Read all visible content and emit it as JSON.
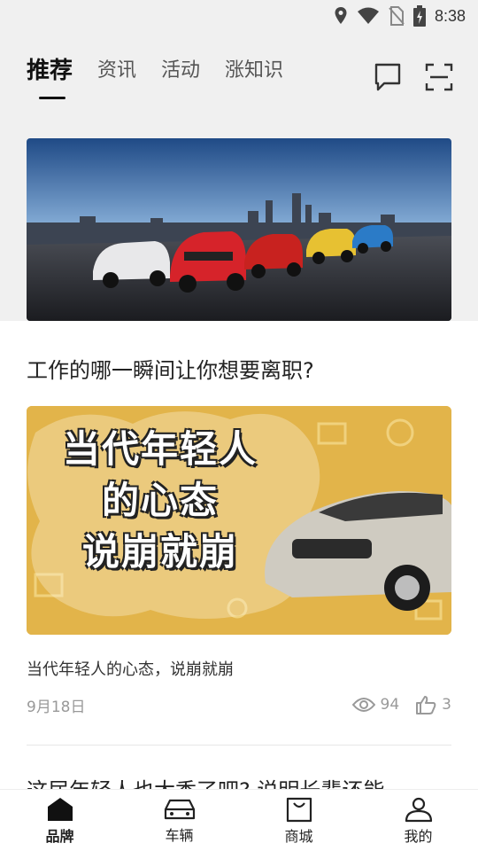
{
  "status_bar": {
    "time": "8:38"
  },
  "tabs": [
    {
      "label": "推荐",
      "active": true
    },
    {
      "label": "资讯",
      "active": false
    },
    {
      "label": "活动",
      "active": false
    },
    {
      "label": "涨知识",
      "active": false
    }
  ],
  "article": {
    "title": "工作的哪一瞬间让你想要离职?",
    "cover_text": [
      "当代年轻人",
      "的心态",
      "说崩就崩"
    ],
    "subtitle": "当代年轻人的心态，说崩就崩",
    "date": "9月18日",
    "views": "94",
    "likes": "3"
  },
  "next_article": {
    "title_partial": "这届年轻人也太香了吧? 说明长辈还能"
  },
  "bottom_nav": [
    {
      "label": "品牌",
      "icon": "home-icon",
      "active": true
    },
    {
      "label": "车辆",
      "icon": "car-icon",
      "active": false
    },
    {
      "label": "商城",
      "icon": "shopping-bag-icon",
      "active": false
    },
    {
      "label": "我的",
      "icon": "user-icon",
      "active": false
    }
  ],
  "colors": {
    "accent": "#111111",
    "cover_bg": "#e2b44a",
    "top_bg": "#f0f0f0"
  }
}
